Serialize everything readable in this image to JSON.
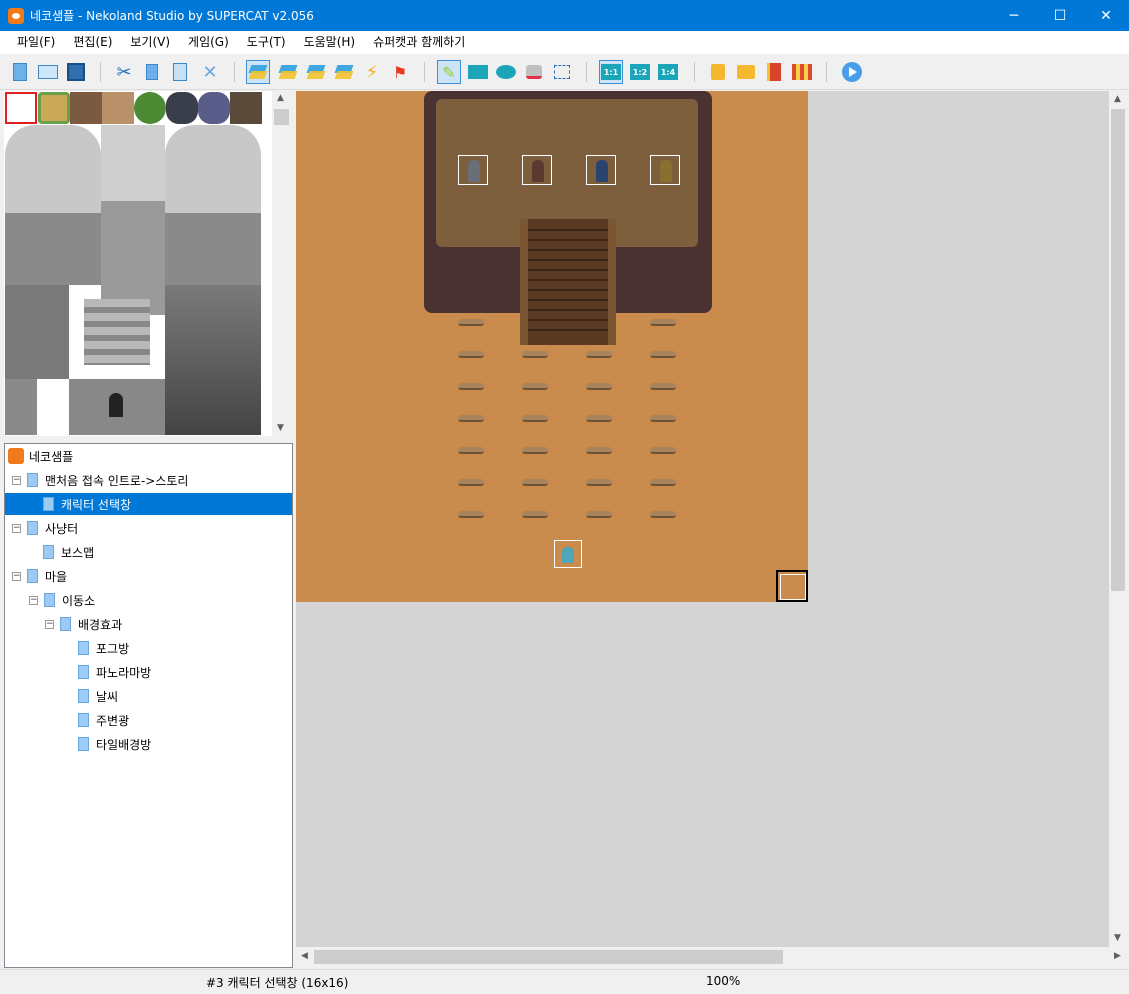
{
  "window": {
    "title": "네코샘플 - Nekoland Studio by SUPERCAT v2.056",
    "controls": [
      "─",
      "☐",
      "✕"
    ]
  },
  "menu": [
    "파일(F)",
    "편집(E)",
    "보기(V)",
    "게임(G)",
    "도구(T)",
    "도움말(H)",
    "슈퍼캣과 함께하기"
  ],
  "toolbar": {
    "scale_labels": [
      "1:1",
      "1:2",
      "1:4"
    ],
    "icons": [
      "new-file-icon",
      "open-folder-icon",
      "save-icon",
      "cut-icon",
      "copy-icon",
      "paste-icon",
      "delete-icon",
      "layer-1-icon",
      "layer-2-icon",
      "layer-3-icon",
      "layer-4-icon",
      "event-lightning-icon",
      "flag-icon",
      "pencil-icon",
      "rectangle-icon",
      "ellipse-icon",
      "fill-bucket-icon",
      "selection-icon",
      "scale-1-1-icon",
      "scale-1-2-icon",
      "scale-1-4-icon",
      "map-tree-icon",
      "music-folder-icon",
      "book-icon",
      "shop-icon",
      "play-icon"
    ]
  },
  "tree": {
    "items": [
      {
        "label": "네코샘플",
        "depth": 0,
        "toggle": "",
        "root": true
      },
      {
        "label": "맨처음 접속 인트로->스토리",
        "depth": 0,
        "toggle": "⊟"
      },
      {
        "label": "캐릭터 선택창",
        "depth": 1,
        "toggle": "",
        "selected": true
      },
      {
        "label": "사냥터",
        "depth": 0,
        "toggle": "⊟"
      },
      {
        "label": "보스맵",
        "depth": 1,
        "toggle": ""
      },
      {
        "label": "마을",
        "depth": 0,
        "toggle": "⊟"
      },
      {
        "label": "이동소",
        "depth": 1,
        "toggle": "⊟"
      },
      {
        "label": "배경효과",
        "depth": 2,
        "toggle": "⊟"
      },
      {
        "label": "포그방",
        "depth": 3,
        "toggle": ""
      },
      {
        "label": "파노라마방",
        "depth": 3,
        "toggle": ""
      },
      {
        "label": "날씨",
        "depth": 3,
        "toggle": ""
      },
      {
        "label": "주변광",
        "depth": 3,
        "toggle": ""
      },
      {
        "label": "타일배경방",
        "depth": 3,
        "toggle": ""
      }
    ]
  },
  "status": {
    "map_info": "#3 캐릭터 선택창 (16x16)",
    "zoom": "100%"
  },
  "colors": {
    "titlebar": "#0078d7",
    "selection": "#0078d7",
    "map_ground": "#c98c4c",
    "rock_dark": "#4a3232",
    "rock_top": "#7d5f3e"
  }
}
